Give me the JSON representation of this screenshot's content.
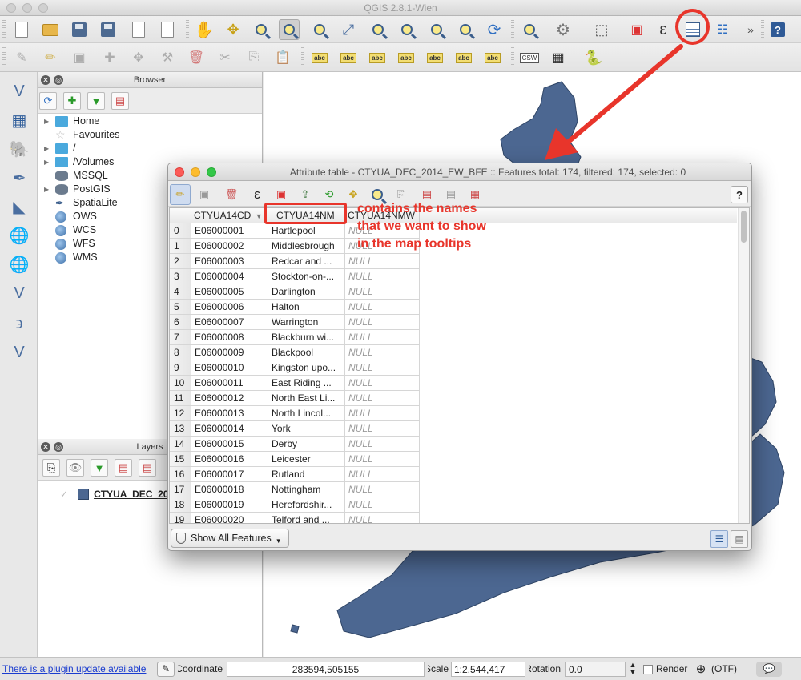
{
  "window": {
    "title": "QGIS 2.8.1-Wien"
  },
  "toolbar_main": {
    "icons": [
      "new-project-icon",
      "open-project-icon",
      "save-project-icon",
      "save-as-icon",
      "new-print-composer-icon",
      "composer-manager-icon",
      "pan-icon",
      "pan-to-selection-icon",
      "zoom-in-icon",
      "zoom-out-icon",
      "zoom-actual-size-icon",
      "zoom-full-icon",
      "zoom-to-selection-icon",
      "zoom-to-layer-icon",
      "zoom-last-icon",
      "zoom-next-icon",
      "refresh-icon",
      "identify-icon",
      "run-feature-action-icon",
      "select-features-icon",
      "deselect-icon",
      "field-calculator-icon",
      "open-attribute-table-icon",
      "statistical-summary-icon",
      "help-icon"
    ],
    "more": "»"
  },
  "toolbar_labels": {
    "abc": "abc",
    "csw": "CSW"
  },
  "browser": {
    "title": "Browser",
    "items": [
      "Home",
      "Favourites",
      "/",
      "/Volumes",
      "MSSQL",
      "PostGIS",
      "SpatiaLite",
      "OWS",
      "WCS",
      "WFS",
      "WMS"
    ]
  },
  "layers": {
    "title": "Layers",
    "layer_name": "CTYUA_DEC_2014_EW_BFE"
  },
  "attribute_table": {
    "title": "Attribute table - CTYUA_DEC_2014_EW_BFE :: Features total: 174, filtered: 174, selected: 0",
    "help": "?",
    "columns": [
      "CTYUA14CD",
      "CTYUA14NM",
      "CTYUA14NMW"
    ],
    "sort_indicator": "▼",
    "rows": [
      {
        "n": "0",
        "cd": "E06000001",
        "nm": "Hartlepool",
        "nmw": "NULL"
      },
      {
        "n": "1",
        "cd": "E06000002",
        "nm": "Middlesbrough",
        "nmw": "NULL"
      },
      {
        "n": "2",
        "cd": "E06000003",
        "nm": "Redcar and ...",
        "nmw": "NULL"
      },
      {
        "n": "3",
        "cd": "E06000004",
        "nm": "Stockton-on-...",
        "nmw": "NULL"
      },
      {
        "n": "4",
        "cd": "E06000005",
        "nm": "Darlington",
        "nmw": "NULL"
      },
      {
        "n": "5",
        "cd": "E06000006",
        "nm": "Halton",
        "nmw": "NULL"
      },
      {
        "n": "6",
        "cd": "E06000007",
        "nm": "Warrington",
        "nmw": "NULL"
      },
      {
        "n": "7",
        "cd": "E06000008",
        "nm": "Blackburn wi...",
        "nmw": "NULL"
      },
      {
        "n": "8",
        "cd": "E06000009",
        "nm": "Blackpool",
        "nmw": "NULL"
      },
      {
        "n": "9",
        "cd": "E06000010",
        "nm": "Kingston upo...",
        "nmw": "NULL"
      },
      {
        "n": "10",
        "cd": "E06000011",
        "nm": "East Riding ...",
        "nmw": "NULL"
      },
      {
        "n": "11",
        "cd": "E06000012",
        "nm": "North East Li...",
        "nmw": "NULL"
      },
      {
        "n": "12",
        "cd": "E06000013",
        "nm": "North Lincol...",
        "nmw": "NULL"
      },
      {
        "n": "13",
        "cd": "E06000014",
        "nm": "York",
        "nmw": "NULL"
      },
      {
        "n": "14",
        "cd": "E06000015",
        "nm": "Derby",
        "nmw": "NULL"
      },
      {
        "n": "15",
        "cd": "E06000016",
        "nm": "Leicester",
        "nmw": "NULL"
      },
      {
        "n": "16",
        "cd": "E06000017",
        "nm": "Rutland",
        "nmw": "NULL"
      },
      {
        "n": "17",
        "cd": "E06000018",
        "nm": "Nottingham",
        "nmw": "NULL"
      },
      {
        "n": "18",
        "cd": "E06000019",
        "nm": "Herefordshir...",
        "nmw": "NULL"
      },
      {
        "n": "19",
        "cd": "E06000020",
        "nm": "Telford and ...",
        "nmw": "NULL"
      }
    ],
    "show_features": "Show All Features"
  },
  "annotation": {
    "lines": [
      "contains the names",
      "that we want to show",
      "in the map tooltips"
    ],
    "color": "#e8352b"
  },
  "statusbar": {
    "plugin_update": "There is a plugin update available",
    "coordinate_label": "Coordinate",
    "coordinate_value": "283594,505155",
    "scale_label": "Scale",
    "scale_value": "1:2,544,417",
    "rotation_label": "Rotation",
    "rotation_value": "0.0",
    "render_label": "Render",
    "crs": "(OTF)"
  },
  "colors": {
    "map_fill": "#4c6791",
    "map_stroke": "#2f4566",
    "link": "#1a3ccf"
  }
}
